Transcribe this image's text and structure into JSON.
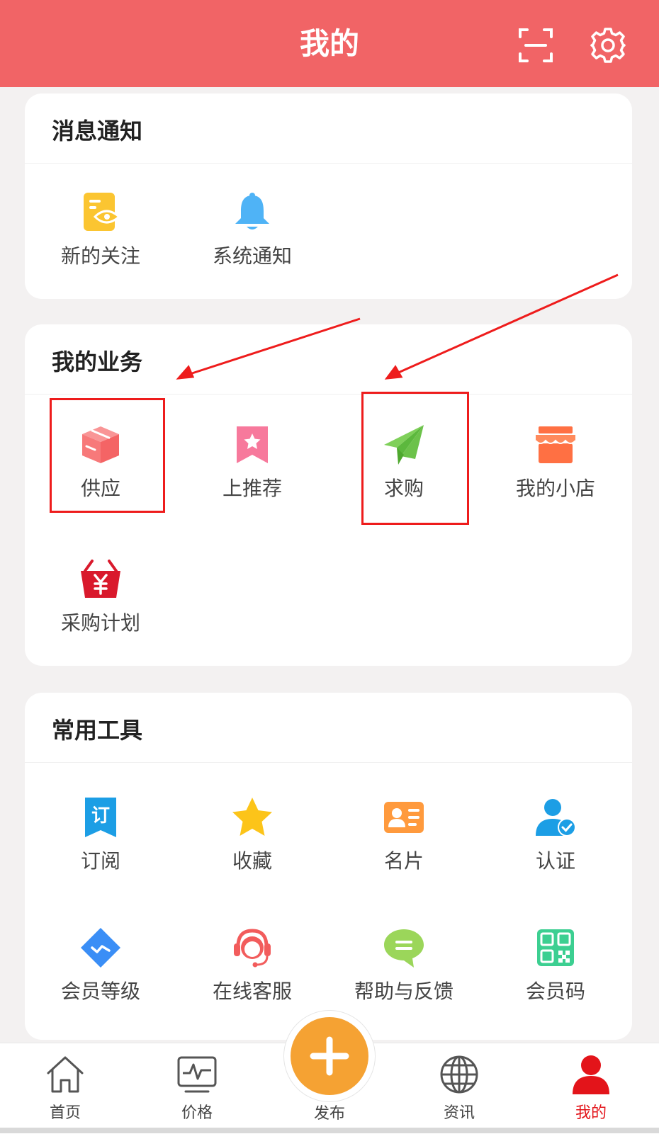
{
  "header": {
    "title": "我的",
    "background": "#f16466"
  },
  "notifications": {
    "title": "消息通知",
    "items": [
      {
        "label": "新的关注",
        "icon": "document-eye-icon",
        "color": "#fbc531"
      },
      {
        "label": "系统通知",
        "icon": "bell-icon",
        "color": "#4fb3f6"
      }
    ]
  },
  "business": {
    "title": "我的业务",
    "items": [
      {
        "label": "供应",
        "icon": "box-icon",
        "color": "#f7797a",
        "highlighted": true
      },
      {
        "label": "上推荐",
        "icon": "bookmark-star-icon",
        "color": "#f7799c"
      },
      {
        "label": "求购",
        "icon": "paper-plane-icon",
        "color": "#6cc24a",
        "highlighted": true
      },
      {
        "label": "我的小店",
        "icon": "shop-icon",
        "color": "#ff7043"
      },
      {
        "label": "采购计划",
        "icon": "basket-yen-icon",
        "color": "#d9192c"
      }
    ]
  },
  "tools": {
    "title": "常用工具",
    "items": [
      {
        "label": "订阅",
        "icon": "subscribe-icon",
        "color": "#1c9ee5",
        "icon_text": "订"
      },
      {
        "label": "收藏",
        "icon": "star-icon",
        "color": "#fcc419"
      },
      {
        "label": "名片",
        "icon": "business-card-icon",
        "color": "#ff9a3d"
      },
      {
        "label": "认证",
        "icon": "verified-user-icon",
        "color": "#1c9ee5"
      },
      {
        "label": "会员等级",
        "icon": "diamond-icon",
        "color": "#3a8ef6"
      },
      {
        "label": "在线客服",
        "icon": "headset-agent-icon",
        "color": "#f25c5c"
      },
      {
        "label": "帮助与反馈",
        "icon": "chat-bubble-icon",
        "color": "#9bd65a"
      },
      {
        "label": "会员码",
        "icon": "qr-code-icon",
        "color": "#3ccf91"
      }
    ]
  },
  "tabbar": {
    "tabs": [
      {
        "label": "首页",
        "icon": "home-icon"
      },
      {
        "label": "价格",
        "icon": "price-chart-icon"
      },
      {
        "label": "资讯",
        "icon": "globe-icon"
      },
      {
        "label": "我的",
        "icon": "user-icon",
        "active": true
      }
    ],
    "publish": {
      "label": "发布",
      "icon": "plus-icon",
      "color": "#f5a233"
    }
  },
  "annotation_color": "#ee1c1c"
}
